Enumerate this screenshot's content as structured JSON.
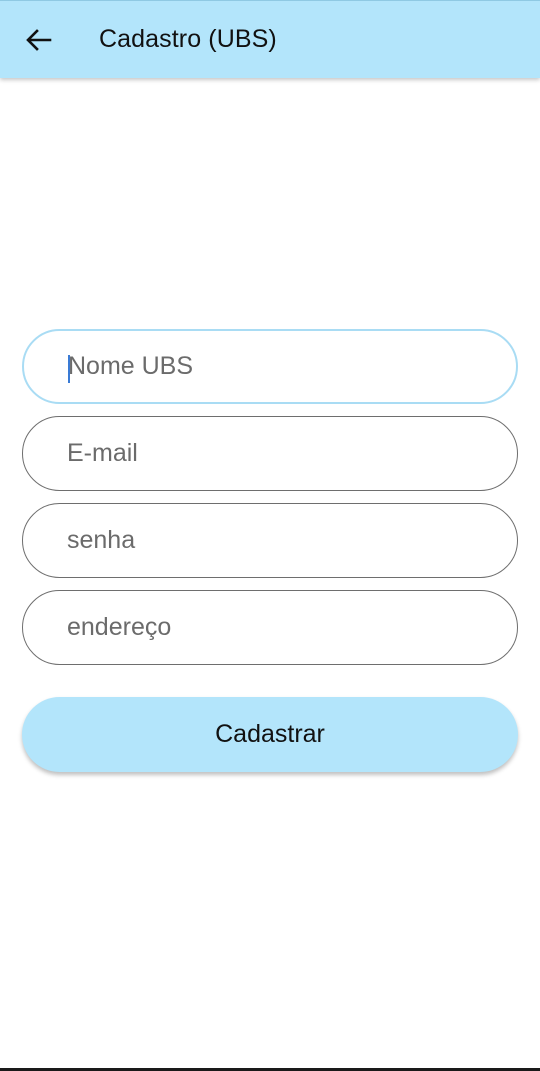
{
  "colors": {
    "app_bar": "#b3e5fb",
    "button": "#b3e5fb",
    "focused_border": "#a9dcf4",
    "field_border": "#6e6e6e"
  },
  "header": {
    "back_icon": "arrow-left-icon",
    "title": "Cadastro (UBS)"
  },
  "form": {
    "nome_ubs": {
      "placeholder": "Nome UBS",
      "value": ""
    },
    "email": {
      "placeholder": "E-mail",
      "value": ""
    },
    "senha": {
      "placeholder": "senha",
      "value": ""
    },
    "endereco": {
      "placeholder": "endereço",
      "value": ""
    },
    "submit_label": "Cadastrar"
  }
}
